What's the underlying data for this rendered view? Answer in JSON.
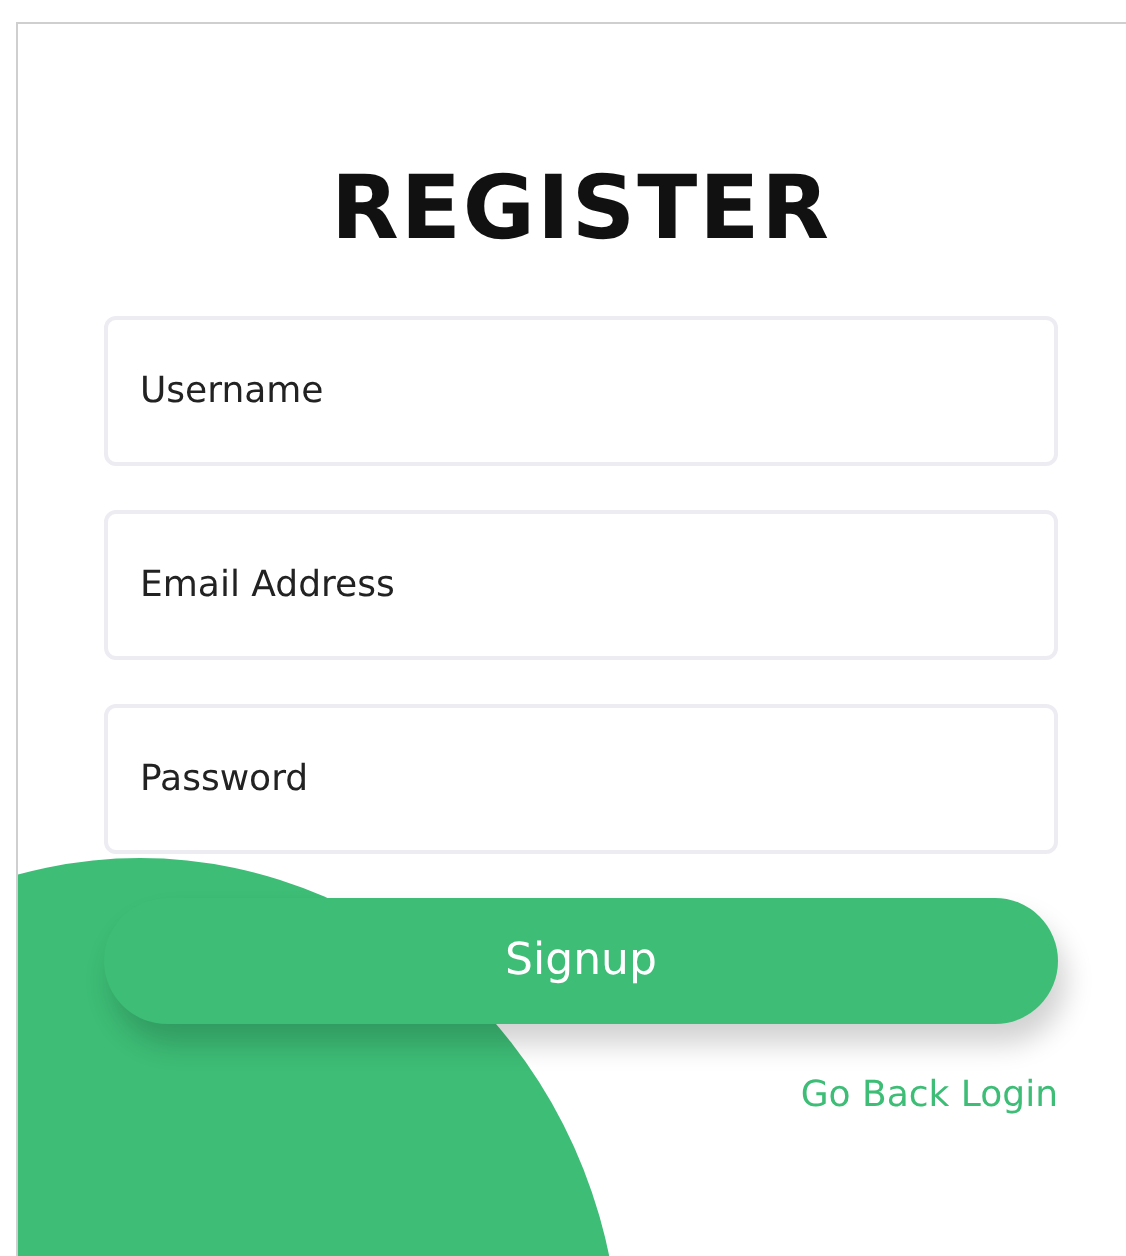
{
  "title": "REGISTER",
  "fields": [
    {
      "placeholder": "Username"
    },
    {
      "placeholder": "Email Address"
    },
    {
      "placeholder": "Password"
    }
  ],
  "submit_button": "Signup",
  "link": "Go Back Login"
}
